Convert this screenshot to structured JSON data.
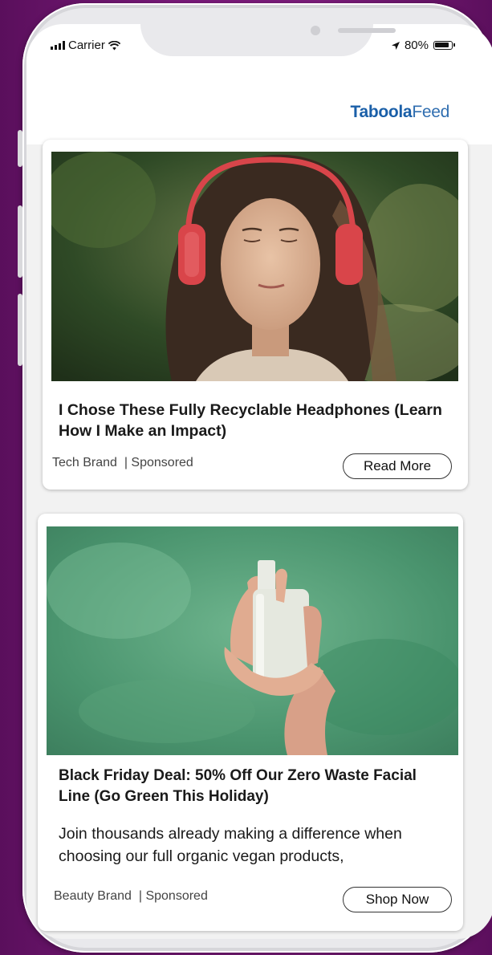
{
  "status_bar": {
    "carrier": "Carrier",
    "battery": "80%"
  },
  "header": {
    "brand_bold": "Taboola",
    "brand_light": "Feed"
  },
  "cards": [
    {
      "image_alt": "Woman wearing red headphones",
      "title": "I Chose These Fully Recyclable Headphones (Learn How I Make an Impact)",
      "description": "",
      "brand": "Tech Brand",
      "sponsored": "| Sponsored",
      "cta": "Read More"
    },
    {
      "image_alt": "Hand holding a white product bottle",
      "title": "Black Friday Deal: 50% Off Our Zero Waste Facial Line (Go Green This Holiday)",
      "description": "Join thousands already making a difference when choosing our full organic vegan products,",
      "brand": "Beauty Brand",
      "sponsored": "| Sponsored",
      "cta": "Shop Now"
    }
  ],
  "colors": {
    "background": "#7a1a7a",
    "brand_blue": "#1a5fa8"
  }
}
